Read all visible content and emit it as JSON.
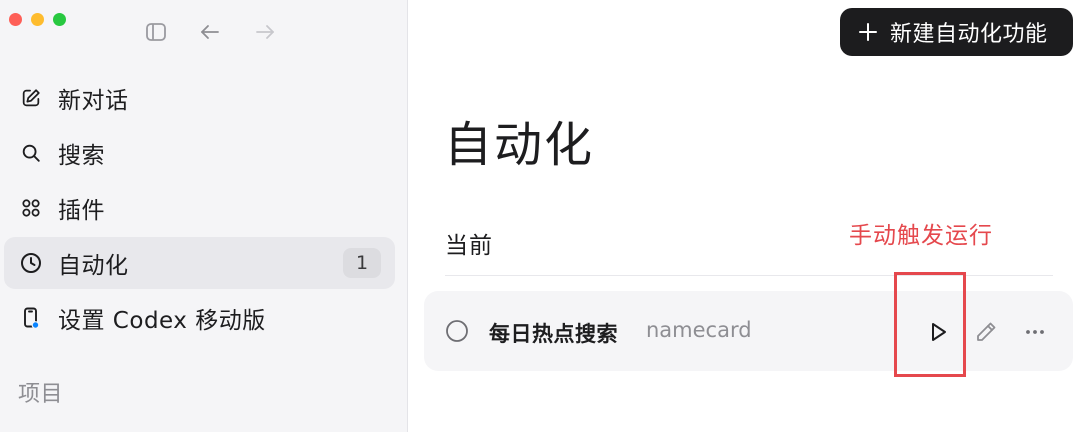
{
  "window": {
    "controls": [
      "close",
      "minimize",
      "zoom"
    ]
  },
  "toolbar": {
    "icons": [
      "sidebar-toggle-icon",
      "arrow-left-icon",
      "arrow-right-icon"
    ]
  },
  "sidebar": {
    "items": [
      {
        "label": "新对话",
        "icon": "compose-icon",
        "active": false
      },
      {
        "label": "搜索",
        "icon": "search-icon",
        "active": false
      },
      {
        "label": "插件",
        "icon": "plugins-grid-icon",
        "active": false
      },
      {
        "label": "自动化",
        "icon": "clock-icon",
        "active": true,
        "badge": "1"
      },
      {
        "label": "设置 Codex 移动版",
        "icon": "phone-icon",
        "active": false
      }
    ],
    "section_label": "项目"
  },
  "header": {
    "new_button_label": "新建自动化功能"
  },
  "main": {
    "title": "自动化",
    "section_title": "当前",
    "annotation": "手动触发运行",
    "tasks": [
      {
        "name": "每日热点搜索",
        "meta": "namecard"
      }
    ]
  },
  "colors": {
    "accent_red": "#e5484d",
    "sidebar_bg": "#f5f5f7",
    "button_dark": "#1c1c1e",
    "status_blue": "#0a84ff"
  }
}
